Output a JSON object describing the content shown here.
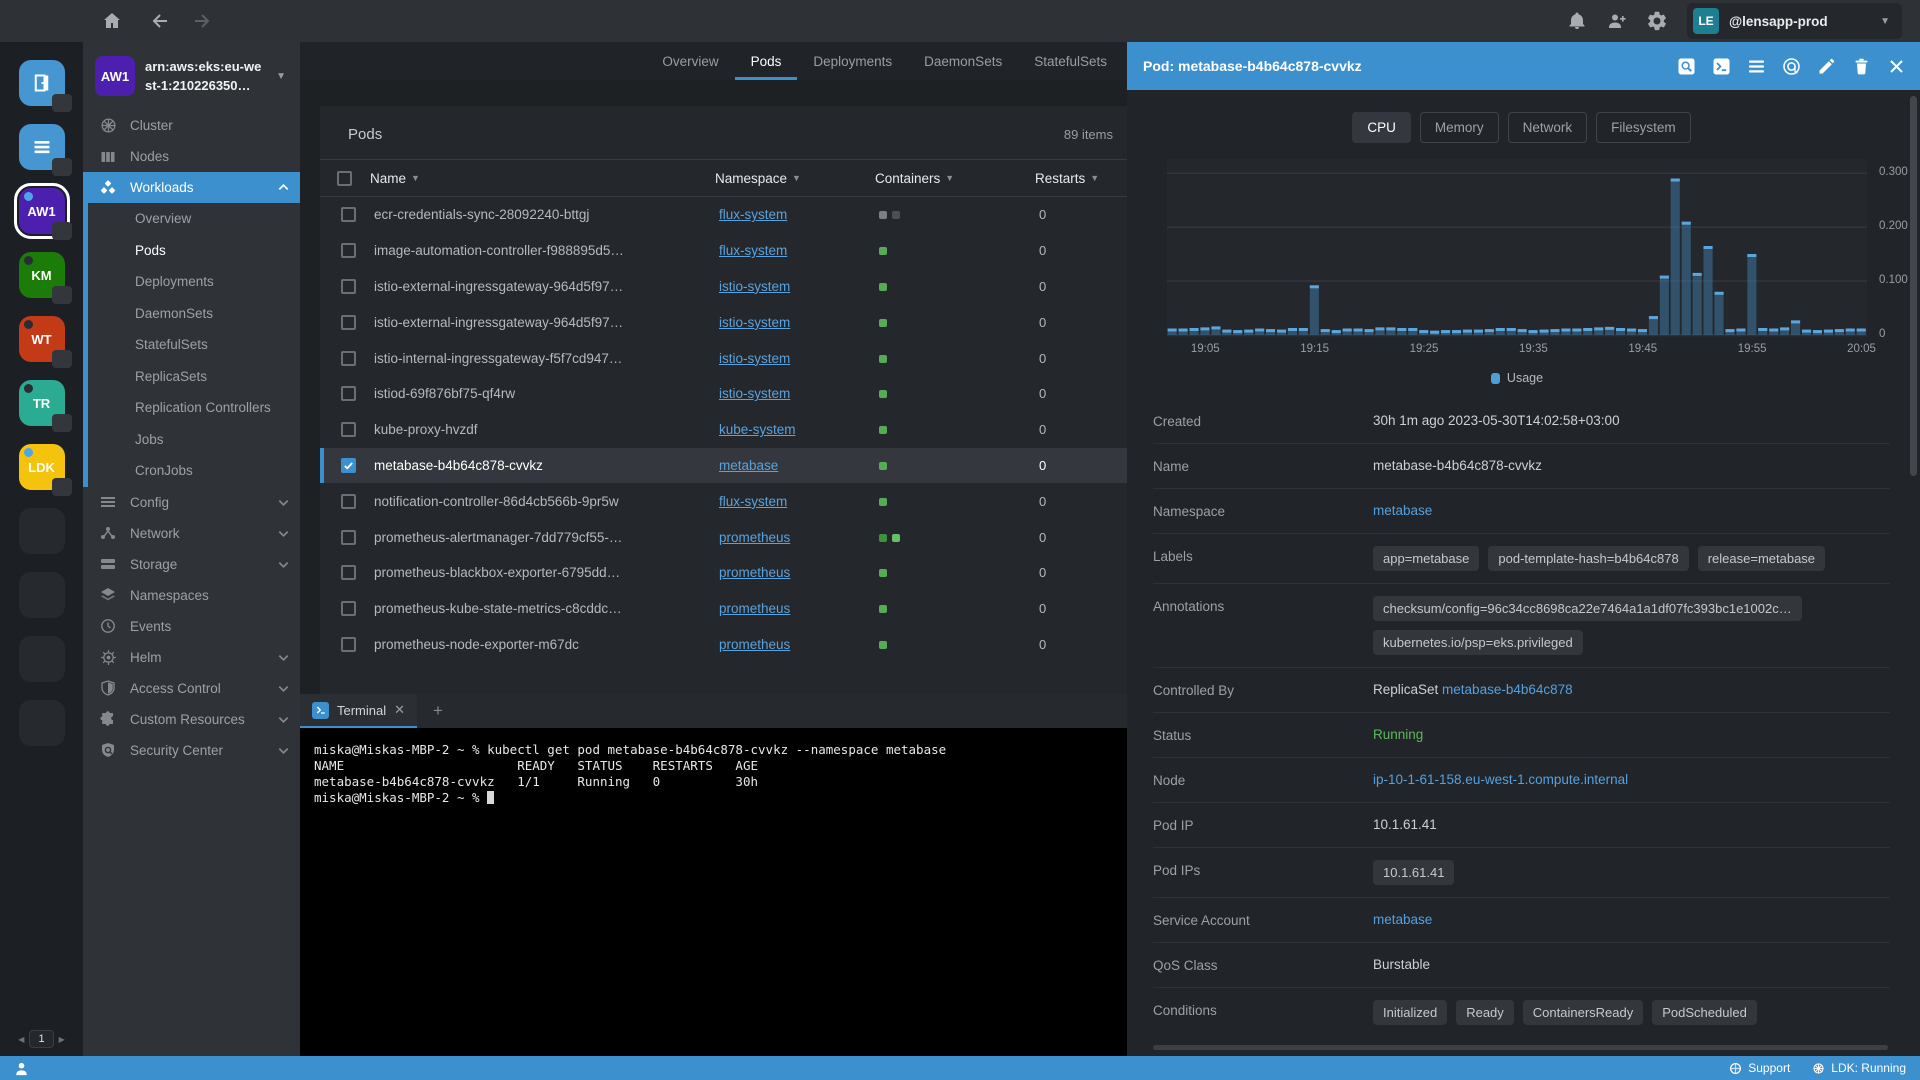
{
  "topbar": {
    "nav_icons": [
      "home",
      "back",
      "forward"
    ],
    "action_icons": [
      "notifications",
      "invite-user",
      "settings"
    ],
    "account": {
      "avatar": "LE",
      "name": "@lensapp-prod"
    }
  },
  "rail": {
    "app_icons": [
      "catalog-door",
      "catalog-list"
    ],
    "clusters": [
      {
        "abbr": "AW1",
        "color": "#4c1fae",
        "active": true,
        "dot": "#4da6e8"
      },
      {
        "abbr": "KM",
        "color": "#1b7c0a",
        "active": false,
        "dot": "#2a2e33"
      },
      {
        "abbr": "WT",
        "color": "#c23a16",
        "active": false,
        "dot": "#2a2e33"
      },
      {
        "abbr": "TR",
        "color": "#2bab92",
        "active": false,
        "dot": "#2a2e33"
      },
      {
        "abbr": "LDK",
        "color": "#f4c30d",
        "active": false,
        "dot": "#4da6e8"
      }
    ],
    "placeholders": 4,
    "pagination": {
      "prev": "◀",
      "page": "1",
      "next": "▶"
    }
  },
  "sidebar": {
    "cluster_abbr": "AW1",
    "cluster_name": "arn:aws:eks:eu-west-1:210226350…",
    "items": [
      {
        "label": "Cluster",
        "icon": "kube-wheel"
      },
      {
        "label": "Nodes",
        "icon": "nodes"
      },
      {
        "label": "Workloads",
        "icon": "cubes",
        "active": true,
        "chevron": "up"
      },
      {
        "label": "Overview",
        "sub": true
      },
      {
        "label": "Pods",
        "sub": true,
        "current": true
      },
      {
        "label": "Deployments",
        "sub": true
      },
      {
        "label": "DaemonSets",
        "sub": true
      },
      {
        "label": "StatefulSets",
        "sub": true
      },
      {
        "label": "ReplicaSets",
        "sub": true
      },
      {
        "label": "Replication Controllers",
        "sub": true
      },
      {
        "label": "Jobs",
        "sub": true
      },
      {
        "label": "CronJobs",
        "sub": true
      },
      {
        "label": "Config",
        "icon": "list",
        "chevron": "down"
      },
      {
        "label": "Network",
        "icon": "share",
        "chevron": "down"
      },
      {
        "label": "Storage",
        "icon": "drives",
        "chevron": "down"
      },
      {
        "label": "Namespaces",
        "icon": "layers"
      },
      {
        "label": "Events",
        "icon": "clock"
      },
      {
        "label": "Helm",
        "icon": "helm-wheel",
        "chevron": "down"
      },
      {
        "label": "Access Control",
        "icon": "shield",
        "chevron": "down"
      },
      {
        "label": "Custom Resources",
        "icon": "puzzle",
        "chevron": "down"
      },
      {
        "label": "Security Center",
        "icon": "security",
        "chevron": "down"
      }
    ]
  },
  "main": {
    "tabs": [
      {
        "label": "Overview"
      },
      {
        "label": "Pods",
        "active": true
      },
      {
        "label": "Deployments"
      },
      {
        "label": "DaemonSets"
      },
      {
        "label": "StatefulSets"
      }
    ],
    "panel": {
      "title": "Pods",
      "count": "89 items",
      "columns": [
        "Name",
        "Namespace",
        "Containers",
        "Restarts"
      ],
      "rows": [
        {
          "name": "ecr-credentials-sync-28092240-bttgj",
          "namespace": "flux-system",
          "containers": [
            "#7c8085",
            "#4c5055"
          ],
          "restarts": "0"
        },
        {
          "name": "image-automation-controller-f988895d5…",
          "namespace": "flux-system",
          "containers": [
            "#57ab57"
          ],
          "restarts": "0"
        },
        {
          "name": "istio-external-ingressgateway-964d5f97…",
          "namespace": "istio-system",
          "containers": [
            "#57ab57"
          ],
          "restarts": "0"
        },
        {
          "name": "istio-external-ingressgateway-964d5f97…",
          "namespace": "istio-system",
          "containers": [
            "#57ab57"
          ],
          "restarts": "0"
        },
        {
          "name": "istio-internal-ingressgateway-f5f7cd947…",
          "namespace": "istio-system",
          "containers": [
            "#57ab57"
          ],
          "restarts": "0"
        },
        {
          "name": "istiod-69f876bf75-qf4rw",
          "namespace": "istio-system",
          "containers": [
            "#57ab57"
          ],
          "restarts": "0"
        },
        {
          "name": "kube-proxy-hvzdf",
          "namespace": "kube-system",
          "containers": [
            "#57ab57"
          ],
          "restarts": "0"
        },
        {
          "name": "metabase-b4b64c878-cvvkz",
          "namespace": "metabase",
          "containers": [
            "#57ab57"
          ],
          "restarts": "0",
          "selected": true
        },
        {
          "name": "notification-controller-86d4cb566b-9pr5w",
          "namespace": "flux-system",
          "containers": [
            "#57ab57"
          ],
          "restarts": "0"
        },
        {
          "name": "prometheus-alertmanager-7dd779cf55-…",
          "namespace": "prometheus",
          "containers": [
            "#3f9142",
            "#63c168"
          ],
          "restarts": "0"
        },
        {
          "name": "prometheus-blackbox-exporter-6795dd…",
          "namespace": "prometheus",
          "containers": [
            "#57ab57"
          ],
          "restarts": "0"
        },
        {
          "name": "prometheus-kube-state-metrics-c8cddc…",
          "namespace": "prometheus",
          "containers": [
            "#57ab57"
          ],
          "restarts": "0"
        },
        {
          "name": "prometheus-node-exporter-m67dc",
          "namespace": "prometheus",
          "containers": [
            "#57ab57"
          ],
          "restarts": "0"
        }
      ]
    }
  },
  "terminal": {
    "tab_label": "Terminal",
    "close_glyph": "✕",
    "add_glyph": "+",
    "lines": [
      "miska@Miskas-MBP-2 ~ % kubectl get pod metabase-b4b64c878-cvvkz --namespace metabase",
      "NAME                       READY   STATUS    RESTARTS   AGE",
      "metabase-b4b64c878-cvvkz   1/1     Running   0          30h",
      "miska@Miskas-MBP-2 ~ % "
    ]
  },
  "detail": {
    "title": "Pod: metabase-b4b64c878-cvvkz",
    "header_icons": [
      "pod-logs",
      "pod-shell",
      "pod-menu",
      "pod-attach",
      "pod-edit",
      "pod-delete",
      "pod-close"
    ],
    "metric_tabs": [
      {
        "label": "CPU",
        "active": true
      },
      {
        "label": "Memory"
      },
      {
        "label": "Network"
      },
      {
        "label": "Filesystem"
      }
    ],
    "rows": [
      {
        "label": "Created",
        "type": "text",
        "value": "30h 1m ago 2023-05-30T14:02:58+03:00"
      },
      {
        "label": "Name",
        "type": "text",
        "value": "metabase-b4b64c878-cvvkz"
      },
      {
        "label": "Namespace",
        "type": "link",
        "value": "metabase"
      },
      {
        "label": "Labels",
        "type": "badges",
        "values": [
          "app=metabase",
          "pod-template-hash=b4b64c878",
          "release=metabase"
        ]
      },
      {
        "label": "Annotations",
        "type": "badges-stack",
        "values": [
          "checksum/config=96c34cc8698ca22e7464a1a1df07fc393bc1e1002c…",
          "kubernetes.io/psp=eks.privileged"
        ]
      },
      {
        "label": "Controlled By",
        "type": "mixed",
        "prefix": "ReplicaSet ",
        "link": "metabase-b4b64c878"
      },
      {
        "label": "Status",
        "type": "status",
        "value": "Running",
        "color": "#5cb85c"
      },
      {
        "label": "Node",
        "type": "link",
        "value": "ip-10-1-61-158.eu-west-1.compute.internal"
      },
      {
        "label": "Pod IP",
        "type": "text",
        "value": "10.1.61.41"
      },
      {
        "label": "Pod IPs",
        "type": "badges",
        "values": [
          "10.1.61.41"
        ]
      },
      {
        "label": "Service Account",
        "type": "link",
        "value": "metabase"
      },
      {
        "label": "QoS Class",
        "type": "text",
        "value": "Burstable"
      },
      {
        "label": "Conditions",
        "type": "badges",
        "values": [
          "Initialized",
          "Ready",
          "ContainersReady",
          "PodScheduled"
        ]
      }
    ]
  },
  "chart_data": {
    "type": "bar",
    "title": "Pod CPU usage (cores)",
    "legend": [
      "Usage"
    ],
    "legend_position": "bottom",
    "grid": true,
    "series_color": "#4e9fd4",
    "ymax": 0.315,
    "y_tick_labels": [
      "0.300",
      "0.200",
      "0.100",
      "0"
    ],
    "y_tick_values": [
      0.3,
      0.2,
      0.1,
      0
    ],
    "x_tick_labels": [
      "19:05",
      "19:15",
      "19:25",
      "19:35",
      "19:45",
      "19:55",
      "20:05"
    ],
    "x_tick_indices": [
      3,
      13,
      23,
      33,
      43,
      53,
      63
    ],
    "values": [
      0.012,
      0.012,
      0.013,
      0.014,
      0.016,
      0.01,
      0.009,
      0.01,
      0.012,
      0.011,
      0.01,
      0.013,
      0.013,
      0.092,
      0.011,
      0.009,
      0.012,
      0.012,
      0.011,
      0.014,
      0.014,
      0.013,
      0.013,
      0.009,
      0.008,
      0.009,
      0.009,
      0.01,
      0.01,
      0.011,
      0.013,
      0.013,
      0.011,
      0.009,
      0.01,
      0.011,
      0.012,
      0.012,
      0.013,
      0.014,
      0.015,
      0.013,
      0.012,
      0.011,
      0.035,
      0.11,
      0.29,
      0.21,
      0.115,
      0.165,
      0.08,
      0.011,
      0.012,
      0.15,
      0.013,
      0.012,
      0.014,
      0.027,
      0.01,
      0.009,
      0.01,
      0.011,
      0.012,
      0.012
    ]
  },
  "statusbar": {
    "support_label": "Support",
    "cluster_status": "LDK: Running"
  }
}
